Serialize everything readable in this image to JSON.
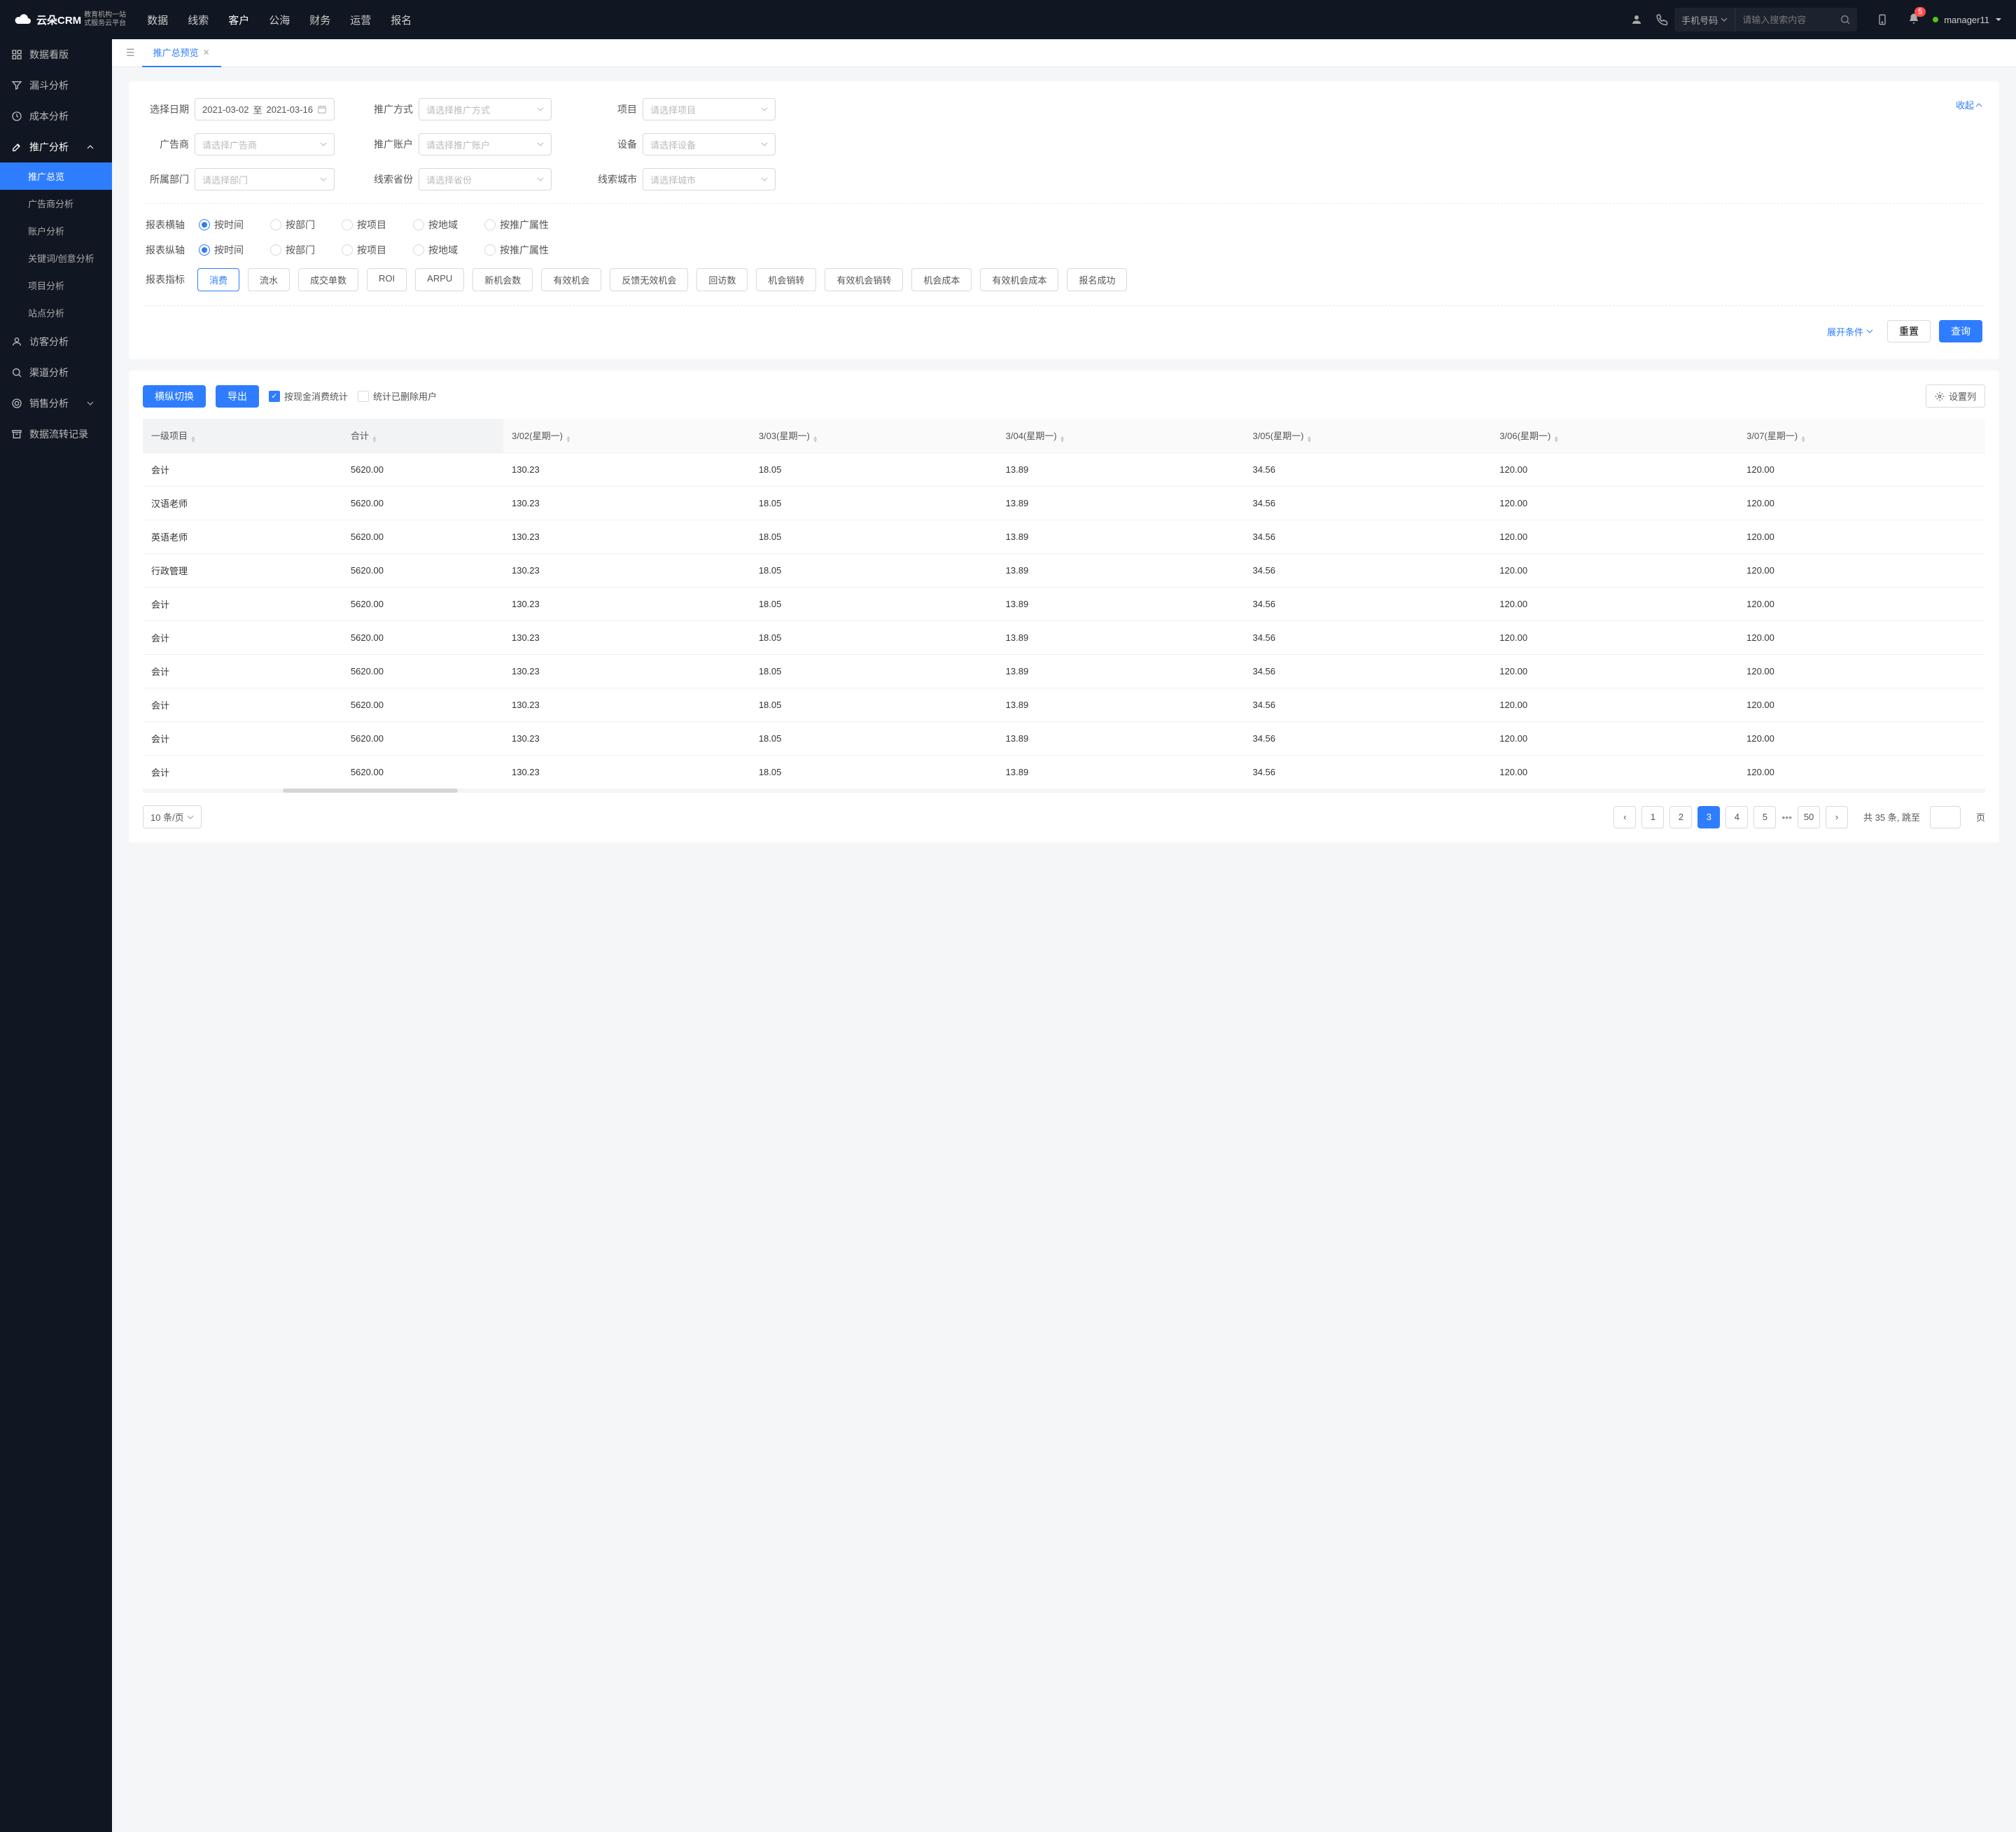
{
  "top": {
    "brand": "云朵CRM",
    "brand_url": "www.yunduocrm.com",
    "brand_sub1": "教育机构一站",
    "brand_sub2": "式服务云平台",
    "nav": [
      "数据",
      "线索",
      "客户",
      "公海",
      "财务",
      "运营",
      "报名"
    ],
    "active_nav": 2,
    "search_type": "手机号码",
    "search_placeholder": "请输入搜索内容",
    "notif_count": 5,
    "user": "manager11"
  },
  "sidebar": {
    "items": [
      {
        "label": "数据看版",
        "icon": "grid-icon"
      },
      {
        "label": "漏斗分析",
        "icon": "filter-icon"
      },
      {
        "label": "成本分析",
        "icon": "clock-icon"
      },
      {
        "label": "推广分析",
        "icon": "edit-icon",
        "expanded": true,
        "children": [
          {
            "label": "推广总览",
            "active": true
          },
          {
            "label": "广告商分析"
          },
          {
            "label": "账户分析"
          },
          {
            "label": "关键词/创意分析"
          },
          {
            "label": "项目分析"
          },
          {
            "label": "站点分析"
          }
        ]
      },
      {
        "label": "访客分析",
        "icon": "person-icon"
      },
      {
        "label": "渠道分析",
        "icon": "magnify-icon"
      },
      {
        "label": "销售分析",
        "icon": "target-icon",
        "caret": "down"
      },
      {
        "label": "数据流转记录",
        "icon": "archive-icon"
      }
    ]
  },
  "tab": {
    "label": "推广总预览"
  },
  "filters": {
    "date_label": "选择日期",
    "date_from": "2021-03-02",
    "date_sep": "至",
    "date_to": "2021-03-16",
    "method_label": "推广方式",
    "method_ph": "请选择推广方式",
    "project_label": "项目",
    "project_ph": "请选择项目",
    "advertiser_label": "广告商",
    "advertiser_ph": "请选择广告商",
    "account_label": "推广账户",
    "account_ph": "请选择推广账户",
    "device_label": "设备",
    "device_ph": "请选择设备",
    "dept_label": "所属部门",
    "dept_ph": "请选择部门",
    "province_label": "线索省份",
    "province_ph": "请选择省份",
    "city_label": "线索城市",
    "city_ph": "请选择城市",
    "collapse": "收起"
  },
  "axis": {
    "h_label": "报表横轴",
    "v_label": "报表纵轴",
    "options": [
      "按时间",
      "按部门",
      "按项目",
      "按地域",
      "按推广属性"
    ],
    "h_sel": 0,
    "v_sel": 0
  },
  "metrics": {
    "label": "报表指标",
    "options": [
      "消费",
      "流水",
      "成交单数",
      "ROI",
      "ARPU",
      "新机会数",
      "有效机会",
      "反馈无效机会",
      "回访数",
      "机会销转",
      "有效机会销转",
      "机会成本",
      "有效机会成本",
      "报名成功"
    ],
    "active": 0
  },
  "actions": {
    "expand": "展开条件",
    "reset": "重置",
    "query": "查询"
  },
  "toolbar": {
    "swap": "横纵切换",
    "export": "导出",
    "cb1": "按现金消费统计",
    "cb2": "统计已删除用户",
    "cols": "设置列"
  },
  "table": {
    "headers": [
      "一级项目",
      "合计",
      "3/02(星期一)",
      "3/03(星期一)",
      "3/04(星期一)",
      "3/05(星期一)",
      "3/06(星期一)",
      "3/07(星期一)"
    ],
    "rows": [
      [
        "会计",
        "5620.00",
        "130.23",
        "18.05",
        "13.89",
        "34.56",
        "120.00",
        "120.00"
      ],
      [
        "汉语老师",
        "5620.00",
        "130.23",
        "18.05",
        "13.89",
        "34.56",
        "120.00",
        "120.00"
      ],
      [
        "英语老师",
        "5620.00",
        "130.23",
        "18.05",
        "13.89",
        "34.56",
        "120.00",
        "120.00"
      ],
      [
        "行政管理",
        "5620.00",
        "130.23",
        "18.05",
        "13.89",
        "34.56",
        "120.00",
        "120.00"
      ],
      [
        "会计",
        "5620.00",
        "130.23",
        "18.05",
        "13.89",
        "34.56",
        "120.00",
        "120.00"
      ],
      [
        "会计",
        "5620.00",
        "130.23",
        "18.05",
        "13.89",
        "34.56",
        "120.00",
        "120.00"
      ],
      [
        "会计",
        "5620.00",
        "130.23",
        "18.05",
        "13.89",
        "34.56",
        "120.00",
        "120.00"
      ],
      [
        "会计",
        "5620.00",
        "130.23",
        "18.05",
        "13.89",
        "34.56",
        "120.00",
        "120.00"
      ],
      [
        "会计",
        "5620.00",
        "130.23",
        "18.05",
        "13.89",
        "34.56",
        "120.00",
        "120.00"
      ],
      [
        "会计",
        "5620.00",
        "130.23",
        "18.05",
        "13.89",
        "34.56",
        "120.00",
        "120.00"
      ]
    ]
  },
  "pager": {
    "size": "10 条/页",
    "pages": [
      "1",
      "2",
      "3",
      "4",
      "5"
    ],
    "more": "50",
    "active": 2,
    "total_prefix": "共 35 条,",
    "jump_label": "跳至",
    "jump_suffix": "页"
  }
}
